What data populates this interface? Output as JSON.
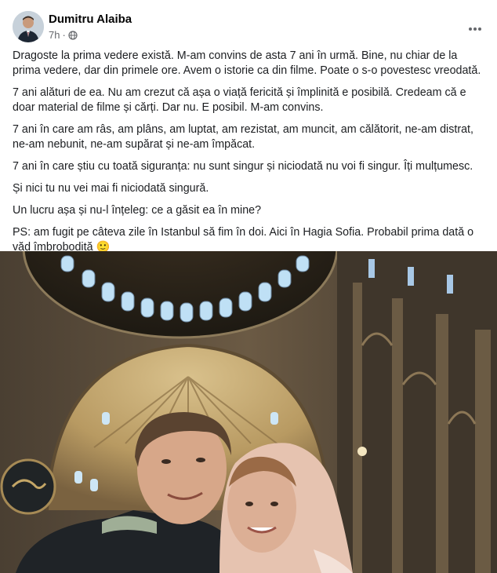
{
  "post": {
    "author": "Dumitru Alaiba",
    "time": "7h",
    "paragraphs": [
      "Dragoste la prima vedere există. M-am convins de asta 7 ani în urmă. Bine, nu chiar de la prima vedere, dar din primele ore. Avem o istorie ca din filme. Poate o s-o povestesc vreodată.",
      "7 ani alături de ea. Nu am crezut că așa o viață fericită și împlinită e posibilă. Credeam că e doar material de filme și cărți. Dar nu. E posibil. M-am convins.",
      "7 ani în care am râs, am plâns, am luptat, am rezistat, am muncit, am călătorit, ne-am distrat, ne-am nebunit, ne-am supărat și ne-am împăcat.",
      "7 ani în care știu cu toată siguranța: nu sunt singur și niciodată nu voi fi singur. Îți mulțumesc.",
      "Și nici tu nu vei mai fi niciodată singură.",
      "Un lucru așa și nu-l înțeleg: ce a găsit ea în mine?",
      "PS: am fugit pe câteva zile în Istanbul să fim în doi. Aici în Hagia Sofia. Probabil prima dată o văd îmbrobodită"
    ],
    "emoji": "🙂",
    "icons": {
      "privacy": "globe-icon",
      "more": "more-options-icon"
    }
  },
  "colors": {
    "text": "#1c1e21",
    "secondary": "#65676b"
  }
}
